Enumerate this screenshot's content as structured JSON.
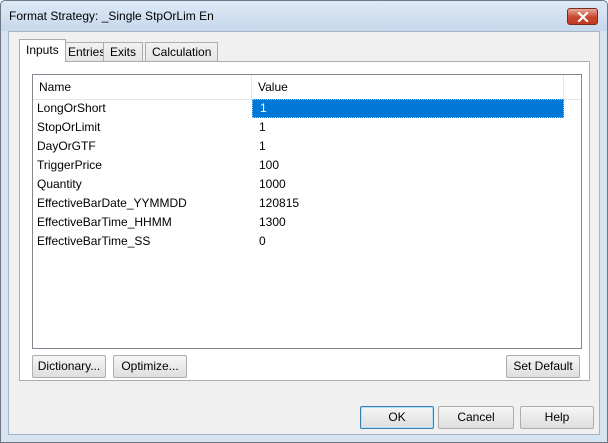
{
  "window": {
    "title": "Format Strategy: _Single StpOrLim En"
  },
  "tabs": [
    {
      "label": "Inputs",
      "active": true
    },
    {
      "label": "Entries",
      "active": false
    },
    {
      "label": "Exits",
      "active": false
    },
    {
      "label": "Calculation",
      "active": false
    }
  ],
  "inputs_table": {
    "columns": [
      "Name",
      "Value"
    ],
    "rows": [
      {
        "name": "LongOrShort",
        "value": "1",
        "selected": true
      },
      {
        "name": "StopOrLimit",
        "value": "1"
      },
      {
        "name": "DayOrGTF",
        "value": "1"
      },
      {
        "name": "TriggerPrice",
        "value": "100"
      },
      {
        "name": "Quantity",
        "value": "1000"
      },
      {
        "name": "EffectiveBarDate_YYMMDD",
        "value": "120815"
      },
      {
        "name": "EffectiveBarTime_HHMM",
        "value": "1300"
      },
      {
        "name": "EffectiveBarTime_SS",
        "value": "0"
      }
    ]
  },
  "panel_buttons": {
    "dictionary": "Dictionary...",
    "optimize": "Optimize...",
    "set_default": "Set Default"
  },
  "dialog_buttons": {
    "ok": "OK",
    "cancel": "Cancel",
    "help": "Help"
  },
  "colors": {
    "selection": "#0078d7",
    "close_button": "#c9462c",
    "frame": "#d6e3f1"
  }
}
